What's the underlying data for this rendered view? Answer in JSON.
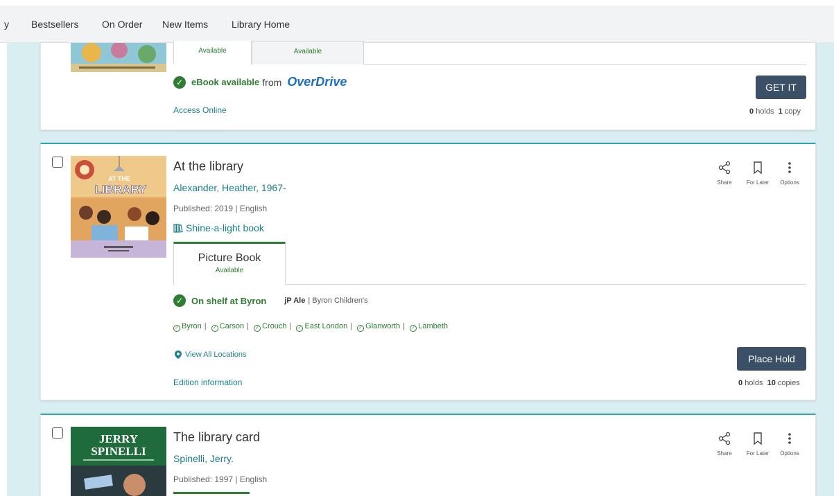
{
  "nav": {
    "partial_item": "y",
    "items": [
      "Bestsellers",
      "On Order",
      "New Items",
      "Library Home"
    ]
  },
  "card1": {
    "tab1_status": "Available",
    "tab2_status": "Available",
    "ebook_available": "eBook available",
    "from_label": "from",
    "provider": "OverDrive",
    "access_link": "Access Online",
    "button": "GET IT",
    "holds_count": "0",
    "holds_label": "holds",
    "copies_count": "1",
    "copies_label": "copy"
  },
  "card2": {
    "title": "At the library",
    "author": "Alexander, Heather, 1967-",
    "published": "Published: 2019 | English",
    "badge": "Shine-a-light book",
    "format_tab": "Picture Book",
    "format_status": "Available",
    "shelf_status": "On shelf at Byron",
    "call_number": "jP Ale",
    "location": "| Byron Children's",
    "branches": [
      "Byron",
      "Carson",
      "Crouch",
      "East London",
      "Glanworth",
      "Lambeth"
    ],
    "view_locations": "View All Locations",
    "edition_link": "Edition information",
    "button": "Place Hold",
    "holds_count": "0",
    "holds_label": "holds",
    "copies_count": "10",
    "copies_label": "copies",
    "cover_title_small": "AT THE",
    "cover_title_big": "LIBRARY"
  },
  "card3": {
    "title": "The library card",
    "author": "Spinelli, Jerry.",
    "published": "Published: 1997 | English",
    "cover_line1": "JERRY",
    "cover_line2": "SPINELLI"
  },
  "actions": {
    "share": "Share",
    "for_later": "For Later",
    "options": "Options"
  },
  "colors": {
    "accent_teal": "#1a7f8e",
    "available_green": "#2e7d32",
    "button_navy": "#3b4f66",
    "page_background": "#d8eef0"
  }
}
